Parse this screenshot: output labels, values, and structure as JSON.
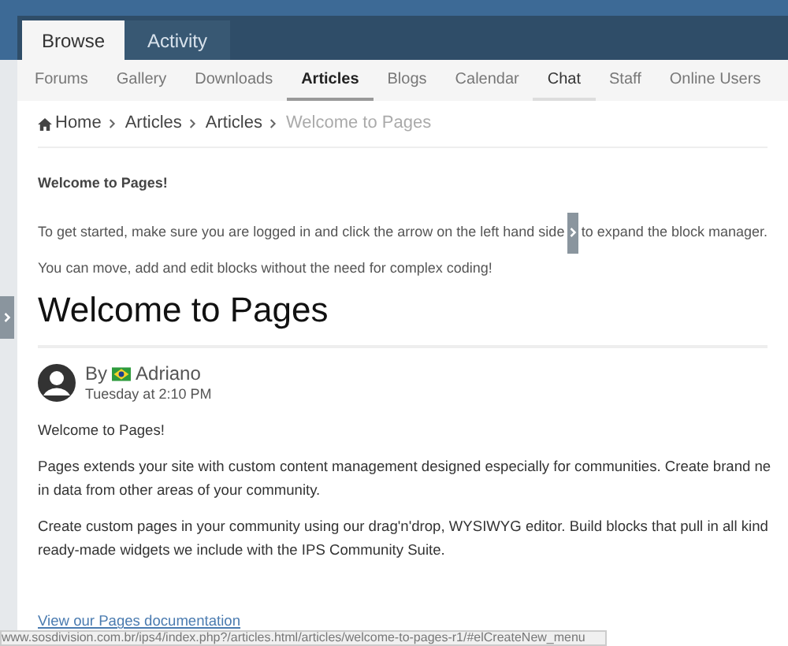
{
  "header_tabs": [
    {
      "label": "Browse",
      "selected": true
    },
    {
      "label": "Activity",
      "selected": false
    }
  ],
  "nav": [
    {
      "label": "Forums",
      "selected": false,
      "highlighted": false
    },
    {
      "label": "Gallery",
      "selected": false,
      "highlighted": false
    },
    {
      "label": "Downloads",
      "selected": false,
      "highlighted": false
    },
    {
      "label": "Articles",
      "selected": true,
      "highlighted": false
    },
    {
      "label": "Blogs",
      "selected": false,
      "highlighted": false
    },
    {
      "label": "Calendar",
      "selected": false,
      "highlighted": false
    },
    {
      "label": "Chat",
      "selected": false,
      "highlighted": true
    },
    {
      "label": "Staff",
      "selected": false,
      "highlighted": false
    },
    {
      "label": "Online Users",
      "selected": false,
      "highlighted": false
    }
  ],
  "breadcrumb": [
    {
      "label": "Home",
      "kind": "home"
    },
    {
      "label": "Articles",
      "kind": "link"
    },
    {
      "label": "Articles",
      "kind": "link"
    },
    {
      "label": "Welcome to Pages",
      "kind": "current"
    }
  ],
  "intro": {
    "title": "Welcome to Pages!",
    "text_before": "To get started, make sure you are logged in and click the arrow on the left hand side",
    "text_after": "to expand the block manager.",
    "note": "You can move, add and edit blocks without the need for complex coding!"
  },
  "article": {
    "title": "Welcome to Pages",
    "by": "By",
    "author": "Adriano",
    "date": "Tuesday at 2:10 PM",
    "paragraphs": [
      [
        "Welcome to Pages!"
      ],
      [
        "Pages extends your site with custom content management designed especially for communities. Create brand ne",
        "in data from other areas of your community."
      ],
      [
        "Create custom pages in your community using our drag'n'drop, WYSIWYG editor. Build blocks that pull in all kind",
        "ready-made widgets we include with the IPS Community Suite."
      ]
    ],
    "link": "View our Pages documentation"
  },
  "status_bar": "www.sosdivision.com.br/ips4/index.php?/articles.html/articles/welcome-to-pages-r1/#elCreateNew_menu"
}
